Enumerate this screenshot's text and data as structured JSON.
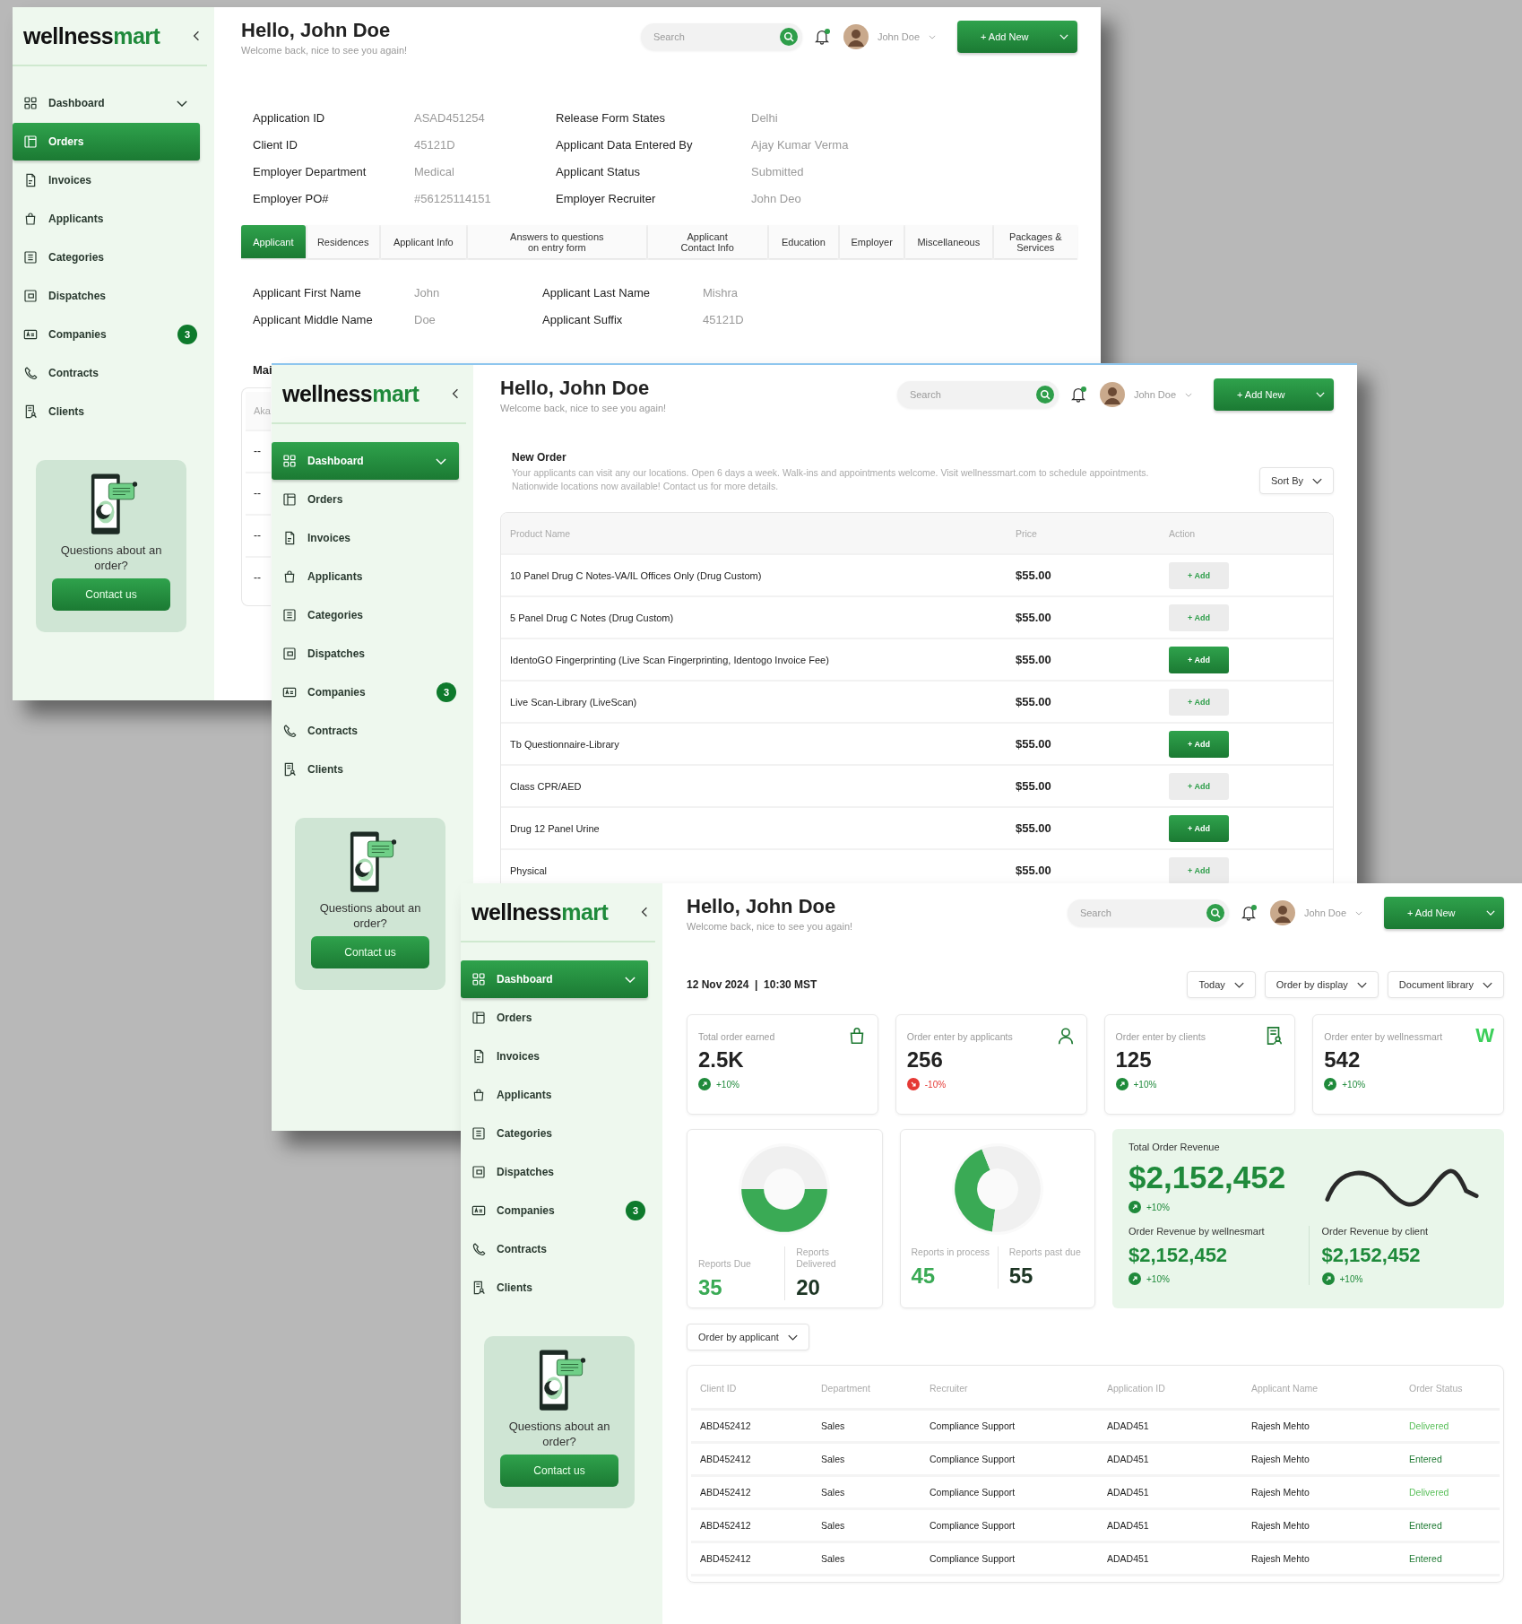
{
  "windows": [
    {
      "kind": "application_details",
      "sidebar": {
        "logo": {
          "name": "wellness",
          "accent": "mart"
        },
        "items": [
          {
            "label": "Dashboard",
            "selected": false,
            "expandable": true
          },
          {
            "label": "Orders",
            "selected": true,
            "expandable": false
          },
          {
            "label": "Invoices",
            "selected": false,
            "expandable": false
          },
          {
            "label": "Applicants",
            "selected": false,
            "expandable": false
          },
          {
            "label": "Categories",
            "selected": false,
            "expandable": false
          },
          {
            "label": "Dispatches",
            "selected": false,
            "expandable": false
          },
          {
            "label": "Companies",
            "selected": false,
            "expandable": false,
            "badge": "3"
          },
          {
            "label": "Contracts",
            "selected": false,
            "expandable": false
          },
          {
            "label": "Clients",
            "selected": false,
            "expandable": false
          }
        ],
        "help_card": {
          "text": "Questions about an order?",
          "button": "Contact us"
        }
      },
      "header": {
        "title": "Hello, John Doe",
        "subtitle": "Welcome back, nice to see you again!",
        "search": {
          "placeholder": "Search"
        },
        "notifications_unread": true,
        "user": "John Doe",
        "add_button": "+ Add New"
      },
      "details": [
        {
          "label": "Application ID",
          "value": "ASAD451254"
        },
        {
          "label": "Release Form States",
          "value": "Delhi"
        },
        {
          "label": "Client ID",
          "value": "45121D"
        },
        {
          "label": "Applicant Data Entered By",
          "value": "Ajay Kumar Verma"
        },
        {
          "label": "Employer Department",
          "value": "Medical"
        },
        {
          "label": "Applicant Status",
          "value": "Submitted"
        },
        {
          "label": "Employer PO#",
          "value": "#56125114151"
        },
        {
          "label": "Employer Recruiter",
          "value": "John Deo"
        }
      ],
      "tabs": [
        {
          "label": "Applicant",
          "selected": true
        },
        {
          "label": "Residences",
          "selected": false
        },
        {
          "label": "Applicant Info",
          "selected": false
        },
        {
          "label": "Answers to questions on entry form",
          "selected": false
        },
        {
          "label": "Applicant Contact Info",
          "selected": false
        },
        {
          "label": "Education",
          "selected": false
        },
        {
          "label": "Employer",
          "selected": false
        },
        {
          "label": "Miscellaneous",
          "selected": false
        },
        {
          "label": "Packages & Services",
          "selected": false
        }
      ],
      "applicant_fields": [
        {
          "label": "Applicant First Name",
          "value": "John"
        },
        {
          "label": "Applicant Last Name",
          "value": "Mishra"
        },
        {
          "label": "Applicant Middle Name",
          "value": "Doe"
        },
        {
          "label": "Applicant Suffix",
          "value": "45121D"
        }
      ],
      "section_title": "Mai",
      "table": {
        "column_1": "Aka",
        "rows": [
          "--",
          "--",
          "--",
          "--"
        ]
      }
    },
    {
      "kind": "new_order",
      "sidebar": {
        "logo": {
          "name": "wellness",
          "accent": "mart"
        },
        "items": [
          {
            "label": "Dashboard",
            "selected": true,
            "expandable": true
          },
          {
            "label": "Orders",
            "selected": false,
            "expandable": false
          },
          {
            "label": "Invoices",
            "selected": false,
            "expandable": false
          },
          {
            "label": "Applicants",
            "selected": false,
            "expandable": false
          },
          {
            "label": "Categories",
            "selected": false,
            "expandable": false
          },
          {
            "label": "Dispatches",
            "selected": false,
            "expandable": false
          },
          {
            "label": "Companies",
            "selected": false,
            "expandable": false,
            "badge": "3"
          },
          {
            "label": "Contracts",
            "selected": false,
            "expandable": false
          },
          {
            "label": "Clients",
            "selected": false,
            "expandable": false
          }
        ],
        "help_card": {
          "text": "Questions about an order?",
          "button": "Contact us"
        }
      },
      "header": {
        "title": "Hello, John Doe",
        "subtitle": "Welcome back, nice to see you again!",
        "search": {
          "placeholder": "Search"
        },
        "notifications_unread": true,
        "user": "John Doe",
        "add_button": "+ Add New"
      },
      "intro": {
        "title": "New Order",
        "paragraphs": [
          "Your applicants can visit any our locations. Open 6 days a week. Walk-ins and appointments welcome. Visit wellnessmart.com to schedule appointments.",
          "Nationwide locations now available! Contact us for more details."
        ]
      },
      "sort_button": "Sort By",
      "table": {
        "columns": [
          "Product Name",
          "Price",
          "Action"
        ],
        "rows": [
          {
            "name": "10 Panel Drug C Notes-VA/IL Offices Only (Drug Custom)",
            "price": "$55.00",
            "action": "+ Add",
            "selected": false
          },
          {
            "name": "5 Panel Drug C Notes (Drug Custom)",
            "price": "$55.00",
            "action": "+ Add",
            "selected": false
          },
          {
            "name": "IdentoGO Fingerprinting (Live Scan Fingerprinting, Identogo Invoice Fee)",
            "price": "$55.00",
            "action": "+ Add",
            "selected": true
          },
          {
            "name": "Live Scan-Library (LiveScan)",
            "price": "$55.00",
            "action": "+ Add",
            "selected": false
          },
          {
            "name": "Tb Questionnaire-Library",
            "price": "$55.00",
            "action": "+ Add",
            "selected": true
          },
          {
            "name": "Class CPR/AED",
            "price": "$55.00",
            "action": "+ Add",
            "selected": false
          },
          {
            "name": "Drug 12 Panel Urine",
            "price": "$55.00",
            "action": "+ Add",
            "selected": true
          },
          {
            "name": "Physical",
            "price": "$55.00",
            "action": "+ Add",
            "selected": false
          }
        ]
      }
    },
    {
      "kind": "dashboard",
      "sidebar": {
        "logo": {
          "name": "wellness",
          "accent": "mart"
        },
        "items": [
          {
            "label": "Dashboard",
            "selected": true,
            "expandable": true
          },
          {
            "label": "Orders",
            "selected": false,
            "expandable": false
          },
          {
            "label": "Invoices",
            "selected": false,
            "expandable": false
          },
          {
            "label": "Applicants",
            "selected": false,
            "expandable": false
          },
          {
            "label": "Categories",
            "selected": false,
            "expandable": false
          },
          {
            "label": "Dispatches",
            "selected": false,
            "expandable": false
          },
          {
            "label": "Companies",
            "selected": false,
            "expandable": false,
            "badge": "3"
          },
          {
            "label": "Contracts",
            "selected": false,
            "expandable": false
          },
          {
            "label": "Clients",
            "selected": false,
            "expandable": false
          }
        ],
        "help_card": {
          "text": "Questions about an order?",
          "button": "Contact us"
        }
      },
      "header": {
        "title": "Hello, John Doe",
        "subtitle": "Welcome back, nice to see you again!",
        "search": {
          "placeholder": "Search"
        },
        "notifications_unread": true,
        "user": "John Doe",
        "add_button": "+ Add New"
      },
      "date": "12 Nov 2024  |  10:30 MST",
      "filters": [
        "Today",
        "Order by display",
        "Document library"
      ],
      "stats": [
        {
          "label": "Total order earned",
          "value": "2.5K",
          "delta": "+10%",
          "positive": true
        },
        {
          "label": "Order enter by applicants",
          "value": "256",
          "delta": "-10%",
          "positive": false
        },
        {
          "label": "Order enter by clients",
          "value": "125",
          "delta": "+10%",
          "positive": true
        },
        {
          "label": "Order enter by wellnessmart",
          "value": "542",
          "delta": "+10%",
          "positive": true,
          "icon_text": "W"
        }
      ],
      "donuts": [
        {
          "stats": [
            {
              "label": "Reports Due",
              "value": "35"
            },
            {
              "label": "Reports Delivered",
              "value": "20"
            }
          ]
        },
        {
          "stats": [
            {
              "label": "Reports in process",
              "value": "45"
            },
            {
              "label": "Reports past due",
              "value": "55"
            }
          ]
        }
      ],
      "revenue": {
        "title": "Total Order Revenue",
        "value": "$2,152,452",
        "delta": "+10%",
        "positive": true,
        "breakdown": [
          {
            "label": "Order Revenue by wellnesmart",
            "value": "$2,152,452",
            "delta": "+10%",
            "positive": true
          },
          {
            "label": "Order Revenue by client",
            "value": "$2,152,452",
            "delta": "+10%",
            "positive": true
          }
        ]
      },
      "table_filter": "Order by applicant",
      "table": {
        "columns": [
          "Client ID",
          "Department",
          "Recruiter",
          "Application ID",
          "Applicant Name",
          "Order Status"
        ],
        "rows": [
          {
            "cells": [
              "ABD452412",
              "Sales",
              "Compliance Support",
              "ADAD451",
              "Rajesh Mehto"
            ],
            "status": "Delivered",
            "color": "#5cc05c"
          },
          {
            "cells": [
              "ABD452412",
              "Sales",
              "Compliance Support",
              "ADAD451",
              "Rajesh Mehto"
            ],
            "status": "Entered",
            "color": "#1f7a33"
          },
          {
            "cells": [
              "ABD452412",
              "Sales",
              "Compliance Support",
              "ADAD451",
              "Rajesh Mehto"
            ],
            "status": "Delivered",
            "color": "#5cc05c"
          },
          {
            "cells": [
              "ABD452412",
              "Sales",
              "Compliance Support",
              "ADAD451",
              "Rajesh Mehto"
            ],
            "status": "Entered",
            "color": "#1f7a33"
          },
          {
            "cells": [
              "ABD452412",
              "Sales",
              "Compliance Support",
              "ADAD451",
              "Rajesh Mehto"
            ],
            "status": "Entered",
            "color": "#1f7a33"
          }
        ]
      }
    }
  ]
}
